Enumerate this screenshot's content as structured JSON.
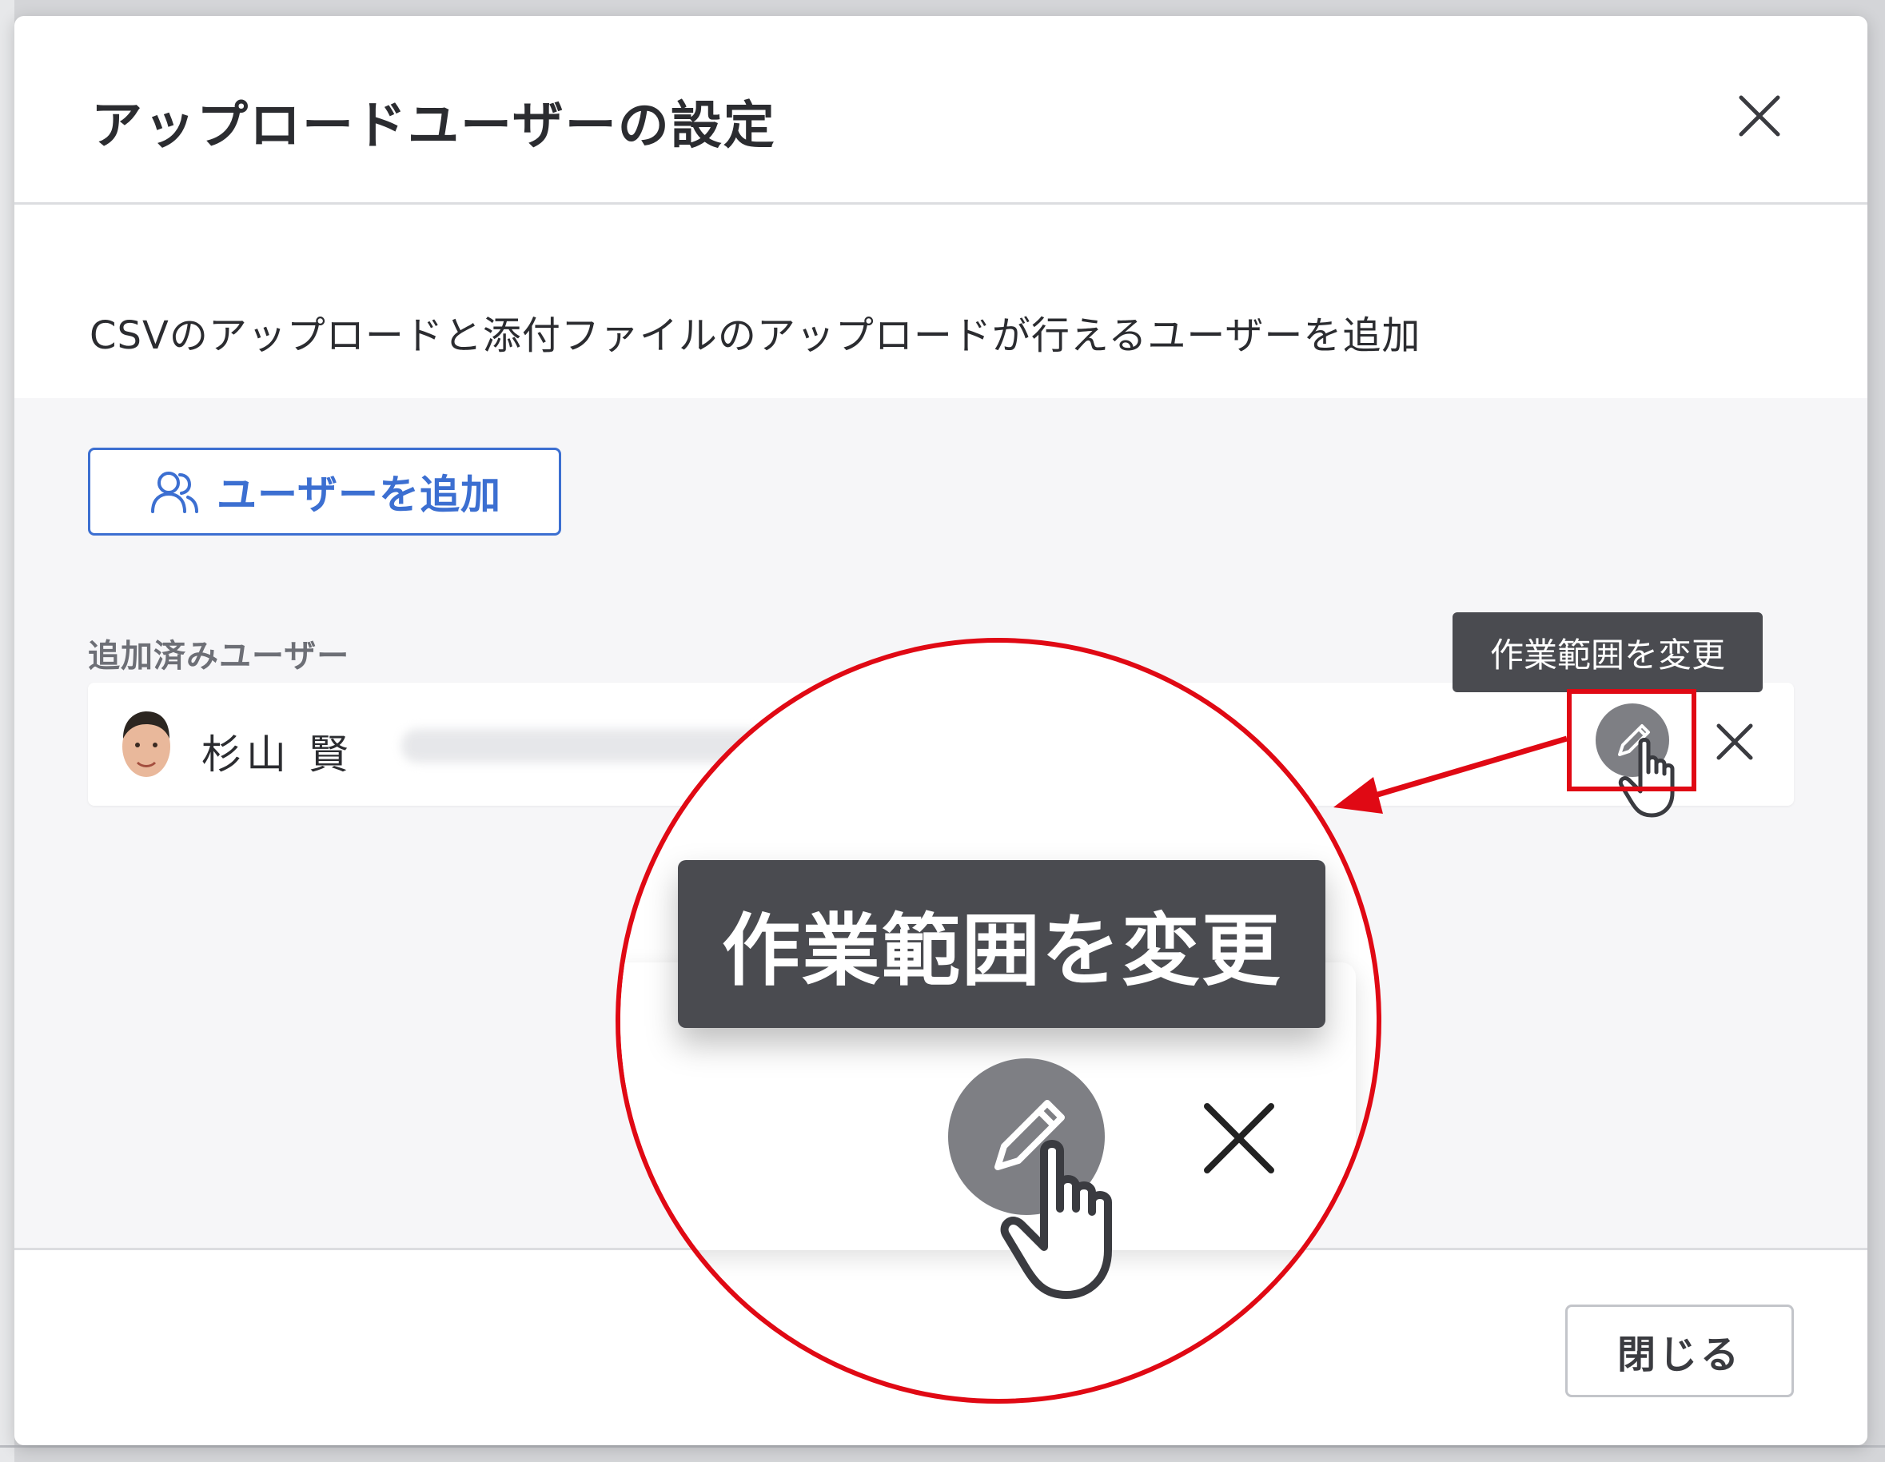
{
  "modal": {
    "title": "アップロードユーザーの設定",
    "description": "CSVのアップロードと添付ファイルのアップロードが行えるユーザーを追加",
    "add_user_label": "ユーザーを追加",
    "section_label": "追加済みユーザー",
    "close_label": "閉じる"
  },
  "user": {
    "name": "杉山 賢"
  },
  "tooltip": {
    "text": "作業範囲を変更"
  },
  "zoom": {
    "tooltip_text": "作業範囲を変更"
  },
  "colors": {
    "accent": "#3c6fd1",
    "highlight": "#e00914",
    "tooltip_bg": "#4a4b50"
  },
  "icons": [
    "close-icon",
    "users-icon",
    "pencil-icon",
    "hand-pointer-icon"
  ]
}
